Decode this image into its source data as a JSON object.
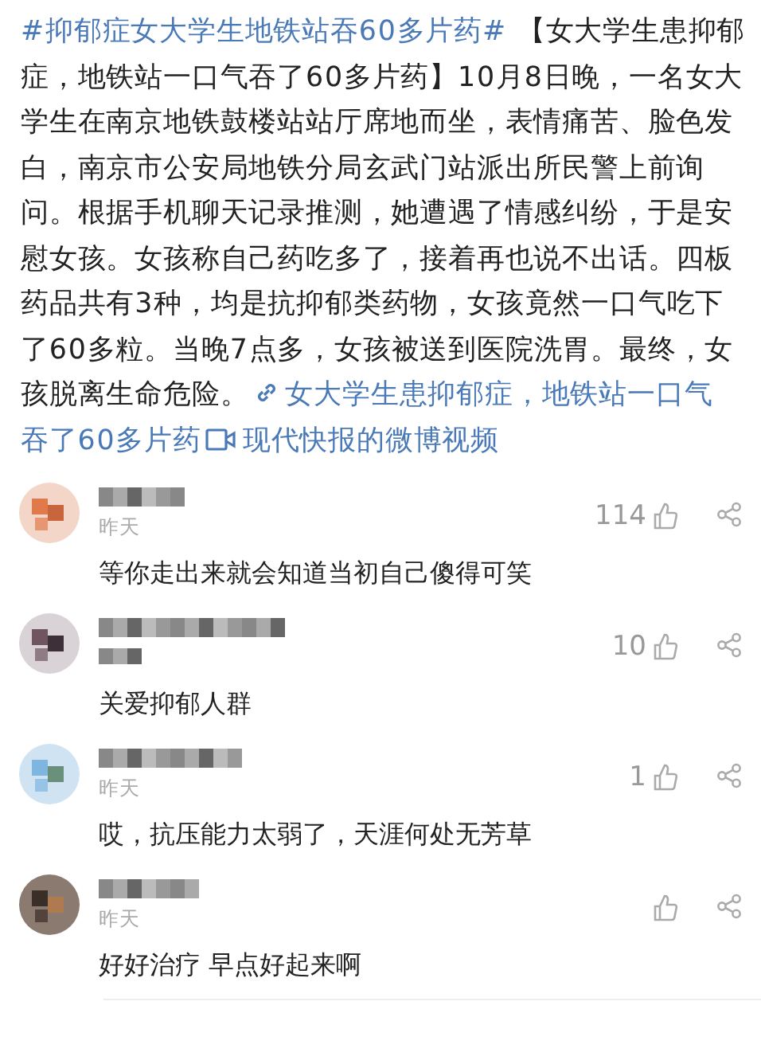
{
  "post": {
    "segments": [
      {
        "kind": "hashtag",
        "text": "#抑郁症女大学生地铁站吞60多片药#"
      },
      {
        "kind": "text",
        "text": " 【女大学生患抑郁症，地铁站一口气吞了60多片药】10月8日晚，一名女大学生在南京地铁鼓楼站站厅席地而坐，表情痛苦、脸色发白，南京市公安局地铁分局玄武门站派出所民警上前询问。根据手机聊天记录推测，她遭遇了情感纠纷，于是安慰女孩。女孩称自己药吃多了，接着再也说不出话。四板药品共有3种，均是抗抑郁类药物，女孩竟然一口气吃下了60多粒。当晚7点多，女孩被送到医院洗胃。最终，女孩脱离生命危险。"
      },
      {
        "kind": "link",
        "text": "女大学生患抑郁症，地铁站一口气"
      },
      {
        "kind": "link-cont",
        "text": "吞了60多片药"
      },
      {
        "kind": "video",
        "text": "现代快报的微博视频"
      }
    ]
  },
  "comments": [
    {
      "time": "昨天",
      "likes": "114",
      "text": "等你走出来就会知道当初自己傻得可笑"
    },
    {
      "likes": "10",
      "text": "关爱抑郁人群"
    },
    {
      "time": "昨天",
      "likes": "1",
      "text": "哎，抗压能力太弱了，天涯何处无芳草"
    },
    {
      "time": "昨天",
      "text": "好好治疗 早点好起来啊"
    }
  ]
}
